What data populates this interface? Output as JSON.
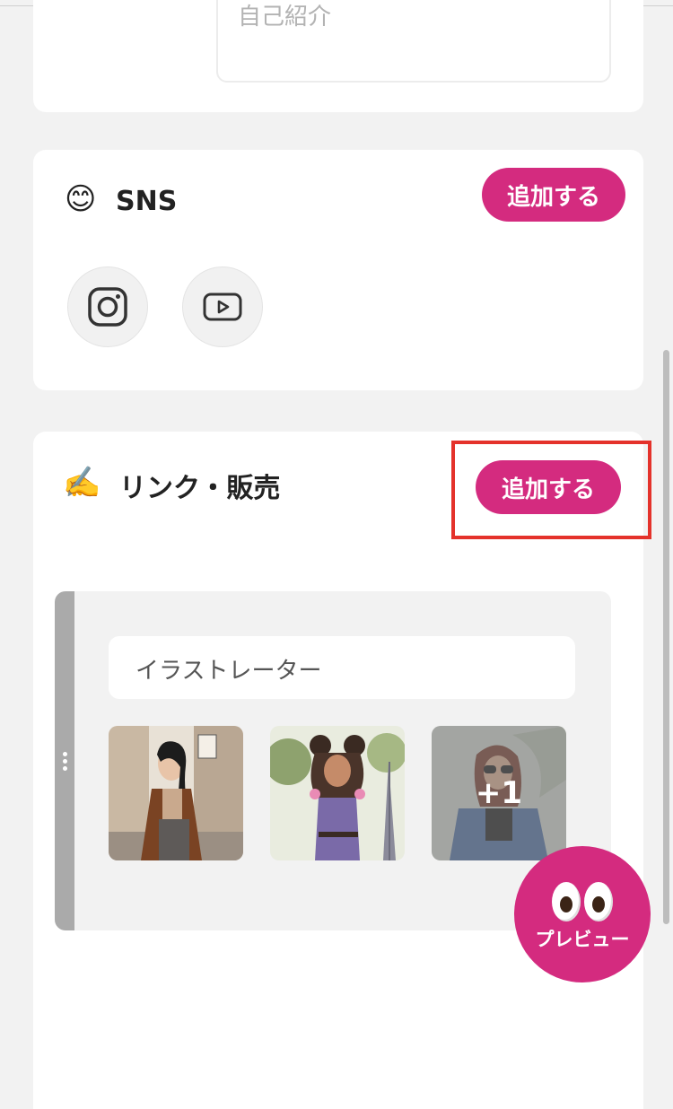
{
  "bio": {
    "placeholder": "自己紹介"
  },
  "sns": {
    "emoji": "😊",
    "title": "SNS",
    "add_label": "追加する",
    "icons": [
      "instagram-icon",
      "youtube-icon"
    ]
  },
  "links": {
    "emoji": "✍️",
    "title": "リンク・販売",
    "add_label": "追加する",
    "item": {
      "title": "イラストレーター",
      "more_count": "+1"
    }
  },
  "preview": {
    "label": "プレビュー",
    "icon": "eyes-icon"
  },
  "colors": {
    "accent": "#d42b7f",
    "highlight": "#e4322b"
  }
}
